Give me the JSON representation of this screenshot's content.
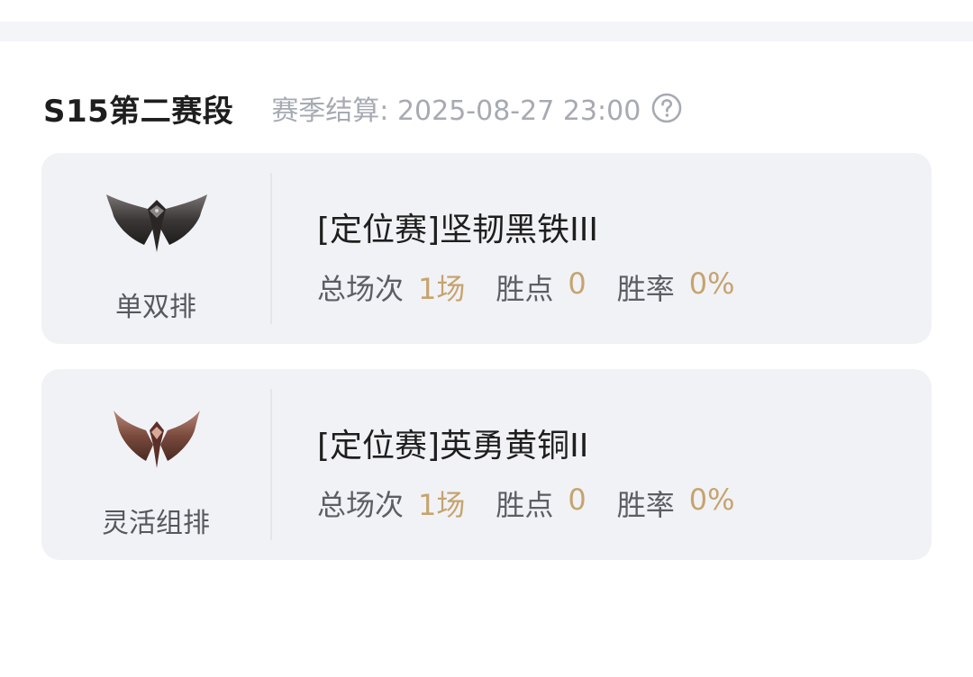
{
  "season": {
    "title": "S15第二赛段",
    "settle_text": "赛季结算: 2025-08-27 23:00"
  },
  "colors": {
    "accent": "#c6a46e",
    "card_bg": "#f1f2f6",
    "muted_text": "#a6aab2",
    "label_text": "#5b5e64"
  },
  "stat_labels": {
    "games": "总场次",
    "points": "胜点",
    "winrate": "胜率"
  },
  "queues": [
    {
      "label": "单双排",
      "tier": "[定位赛]坚韧黑铁III",
      "emblem_icon": "iron-rank-emblem-icon",
      "games": "1场",
      "points": "0",
      "winrate": "0%"
    },
    {
      "label": "灵活组排",
      "tier": "[定位赛]英勇黄铜II",
      "emblem_icon": "bronze-rank-emblem-icon",
      "games": "1场",
      "points": "0",
      "winrate": "0%"
    }
  ]
}
